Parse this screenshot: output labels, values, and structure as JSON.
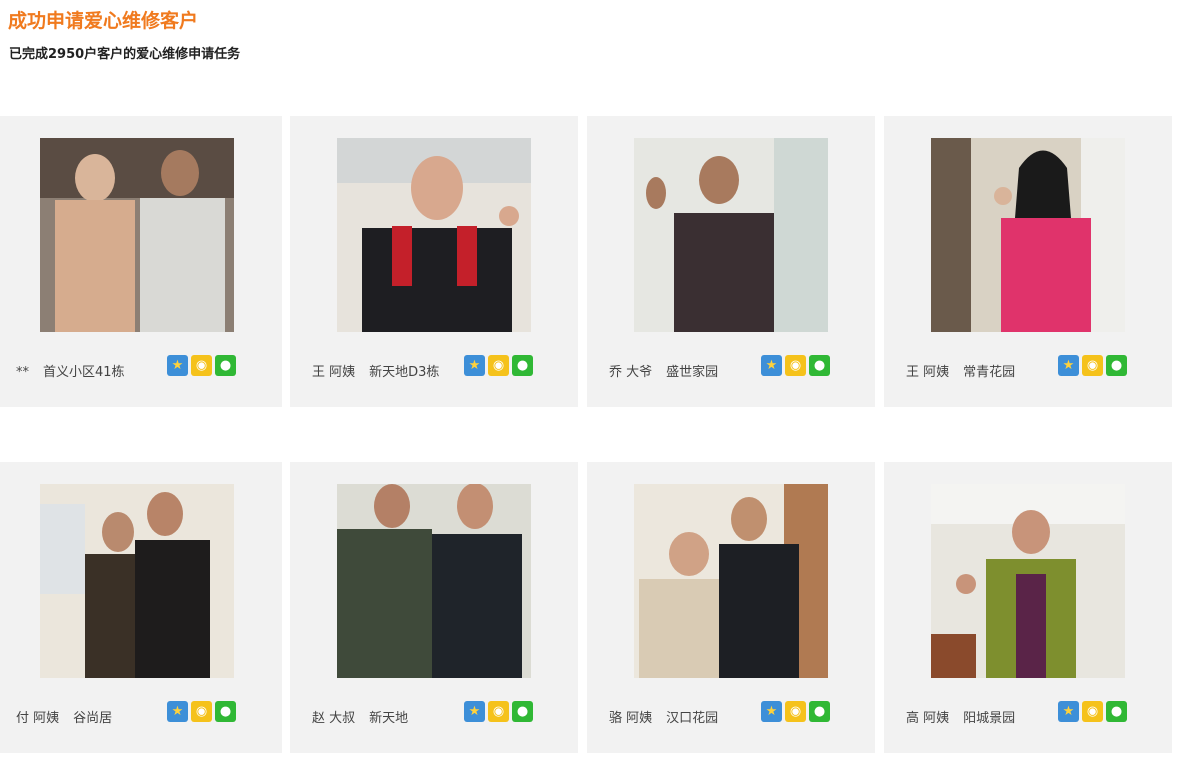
{
  "header": {
    "title": "成功申请爱心维修客户",
    "subtitle": "已完成2950户客户的爱心维修申请任务"
  },
  "share_icons": [
    {
      "name": "qzone-icon",
      "glyph": "★",
      "color": "#3d8fd8"
    },
    {
      "name": "weibo-icon",
      "glyph": "◉",
      "color": "#f5c21b"
    },
    {
      "name": "wechat-icon",
      "glyph": "●",
      "color": "#30b835"
    }
  ],
  "customers": [
    {
      "name": "**",
      "location": "首义小区41栋"
    },
    {
      "name": "王 阿姨",
      "location": "新天地D3栋"
    },
    {
      "name": "乔 大爷",
      "location": "盛世家园"
    },
    {
      "name": "王 阿姨",
      "location": "常青花园"
    },
    {
      "name": "付 阿姨",
      "location": "谷尚居"
    },
    {
      "name": "赵 大叔",
      "location": "新天地"
    },
    {
      "name": "骆 阿姨",
      "location": "汉口花园"
    },
    {
      "name": "高 阿姨",
      "location": "阳城景园"
    }
  ]
}
